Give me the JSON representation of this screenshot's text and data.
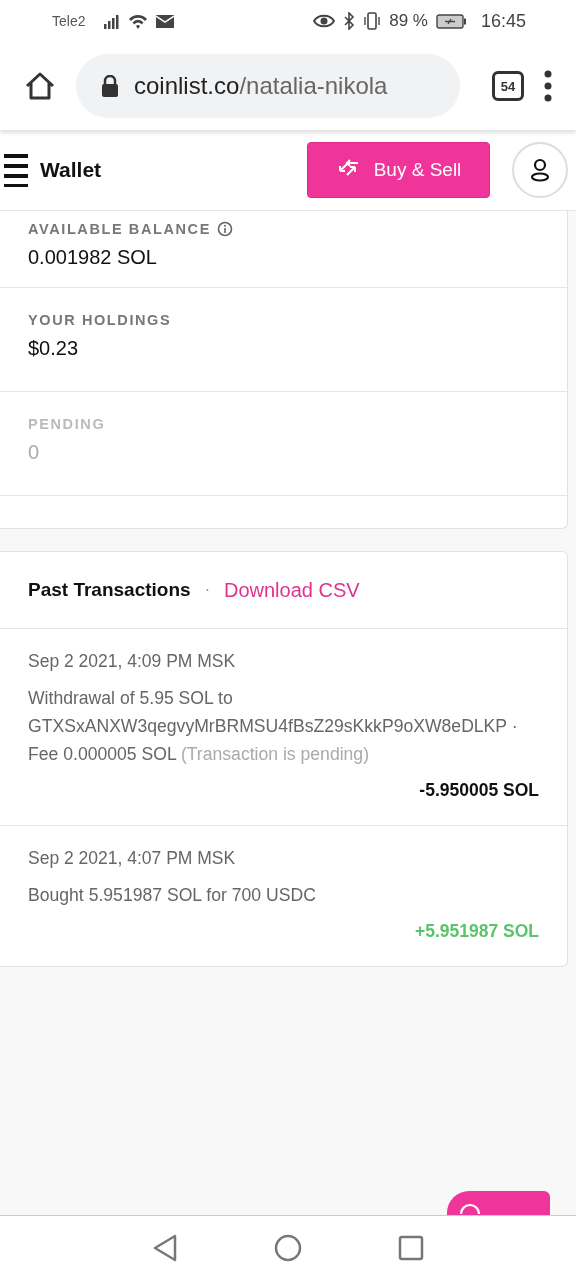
{
  "status_bar": {
    "carrier": "Tele2",
    "battery": "89 %",
    "time": "16:45"
  },
  "browser": {
    "url_host": "coinlist.co",
    "url_path": "/natalia-nikola",
    "tab_count": "54"
  },
  "header": {
    "title": "Wallet",
    "action": "Buy & Sell"
  },
  "balances": [
    {
      "label": "AVAILABLE BALANCE",
      "value": "0.001982 SOL",
      "info": true,
      "disabled": false
    },
    {
      "label": "YOUR HOLDINGS",
      "value": "$0.23",
      "info": false,
      "disabled": false
    },
    {
      "label": "PENDING",
      "value": "0",
      "info": false,
      "disabled": true
    }
  ],
  "transactions_panel": {
    "title": "Past Transactions",
    "separator": "·",
    "link": "Download CSV"
  },
  "transactions": [
    {
      "date": "Sep 2 2021, 4:09 PM MSK",
      "description": "Withdrawal of 5.95 SOL to GTXSxANXW3qegvyMrBRMSU4fBsZ29sKkkP9oXW8eDLKP · Fee 0.000005 SOL",
      "note": "(Transaction is pending)",
      "amount": "-5.950005 SOL",
      "kind": "debit"
    },
    {
      "date": "Sep 2 2021, 4:07 PM MSK",
      "description": "Bought 5.951987 SOL for 700 USDC",
      "amount": "+5.951987 SOL",
      "kind": "credit"
    }
  ]
}
